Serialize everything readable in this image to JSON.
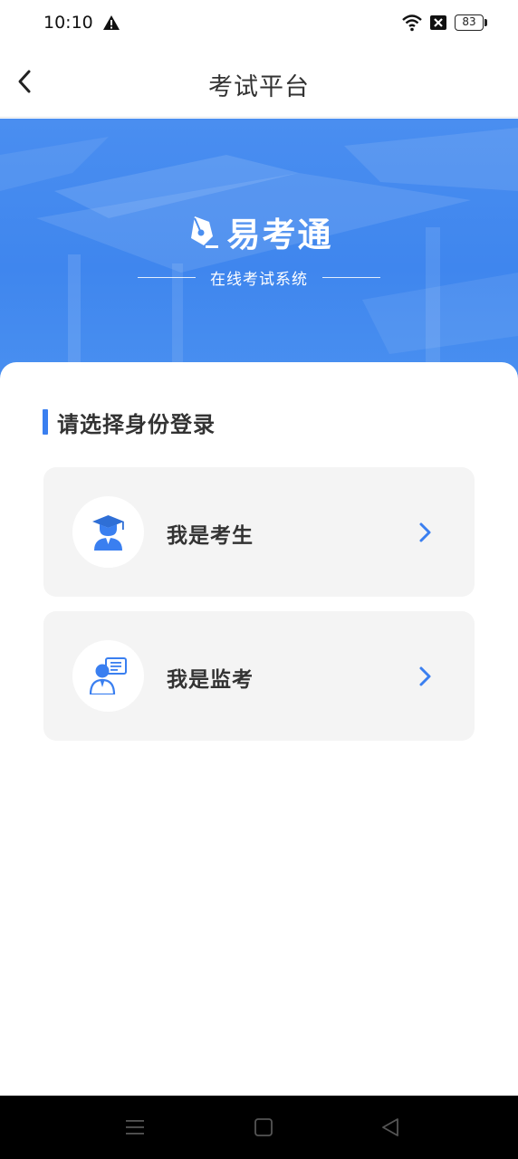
{
  "status_bar": {
    "time": "10:10",
    "battery": "83",
    "icons": [
      "warning-icon",
      "wifi-icon",
      "no-sim-icon",
      "battery-icon"
    ]
  },
  "nav": {
    "title": "考试平台",
    "back_icon": "chevron-left-icon"
  },
  "banner": {
    "app_name": "易考通",
    "subtitle": "在线考试系统",
    "logo_icon": "pen-nib-icon"
  },
  "login": {
    "section_title": "请选择身份登录",
    "roles": [
      {
        "label": "我是考生",
        "icon": "student-graduate-icon"
      },
      {
        "label": "我是监考",
        "icon": "proctor-teacher-icon"
      }
    ]
  },
  "colors": {
    "accent": "#3a7ff0",
    "banner": "#4a8ef0",
    "card_bg": "#f4f4f4",
    "text_primary": "#333333"
  },
  "system_nav": {
    "icons": [
      "menu-icon",
      "home-icon",
      "back-triangle-icon"
    ]
  }
}
